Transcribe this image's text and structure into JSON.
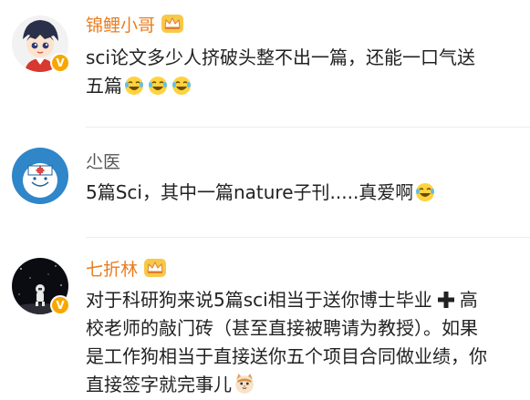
{
  "comments": [
    {
      "username": "锦鲤小哥",
      "lines": [
        "sci论文多少人挤破头整不出一篇，还能一口气送",
        "五篇"
      ],
      "emoji": "laugh-cry-emoji"
    },
    {
      "username": "尐医",
      "lines": [
        "5篇Sci，其中一篇nature子刊.....真爱啊"
      ],
      "emoji": "laugh-cry-emoji"
    },
    {
      "username": "七折林",
      "lines": [
        "对于科研狗来说5篇sci相当于送你博士毕业",
        "校老师的敲门砖（甚至直接被聘请为教授）。如果",
        "是工作狗相当于直接送你五个项目合同做业绩，你",
        "直接签字就完事儿"
      ],
      "line1_suffix": "高",
      "emoji": "cat-emoji",
      "plus_symbol": "plus-icon"
    }
  ],
  "colors": {
    "username_orange": "#ea7c1f",
    "username_gray": "#555555",
    "verified_badge": "#f7a700",
    "text": "#222222"
  }
}
